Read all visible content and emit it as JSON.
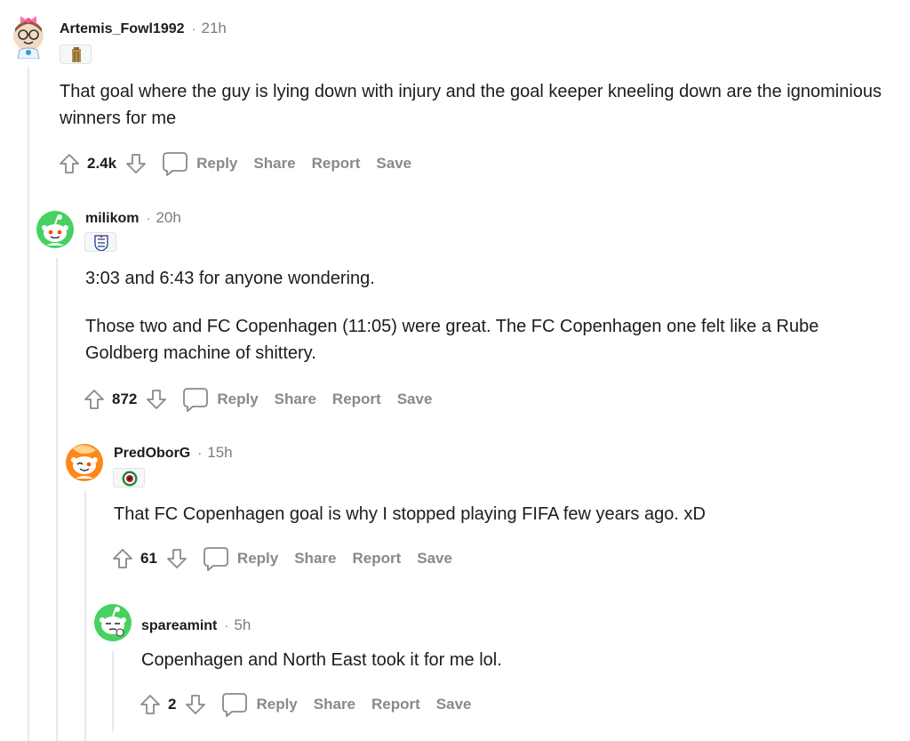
{
  "comments": [
    {
      "username": "Artemis_Fowl1992",
      "separator": "·",
      "time": "21h",
      "body": [
        "That goal where the guy is lying down with injury and the goal keeper kneeling down are the ignominious winners for me"
      ],
      "score": "2.4k",
      "avatar": "avatar-pink-bow-glasses",
      "flair": "tower-flair"
    },
    {
      "username": "milikom",
      "separator": "·",
      "time": "20h",
      "body": [
        "3:03 and 6:43 for anyone wondering.",
        "Those two and FC Copenhagen (11:05) were great. The FC Copenhagen one felt like a Rube Goldberg machine of shittery."
      ],
      "score": "872",
      "avatar": "avatar-green-snoo",
      "flair": "england-crest-flair"
    },
    {
      "username": "PredOborG",
      "separator": "·",
      "time": "15h",
      "body": [
        "That FC Copenhagen goal is why I stopped playing FIFA few years ago. xD"
      ],
      "score": "61",
      "avatar": "avatar-orange-snoo-winking",
      "flair": "football-club-crest-flair"
    },
    {
      "username": "spareamint",
      "separator": "·",
      "time": "5h",
      "body": [
        "Copenhagen and North East took it for me lol."
      ],
      "score": "2",
      "avatar": "avatar-green-snoo-thinking",
      "flair": ""
    }
  ],
  "actions": {
    "reply": "Reply",
    "share": "Share",
    "report": "Report",
    "save": "Save"
  },
  "colors": {
    "text": "#1c1c1c",
    "meta": "#7c7c7c",
    "action": "#878a8c",
    "thread_line": "#e9e9e9",
    "green_avatar": "#46d160",
    "orange_avatar": "#ff8717"
  }
}
